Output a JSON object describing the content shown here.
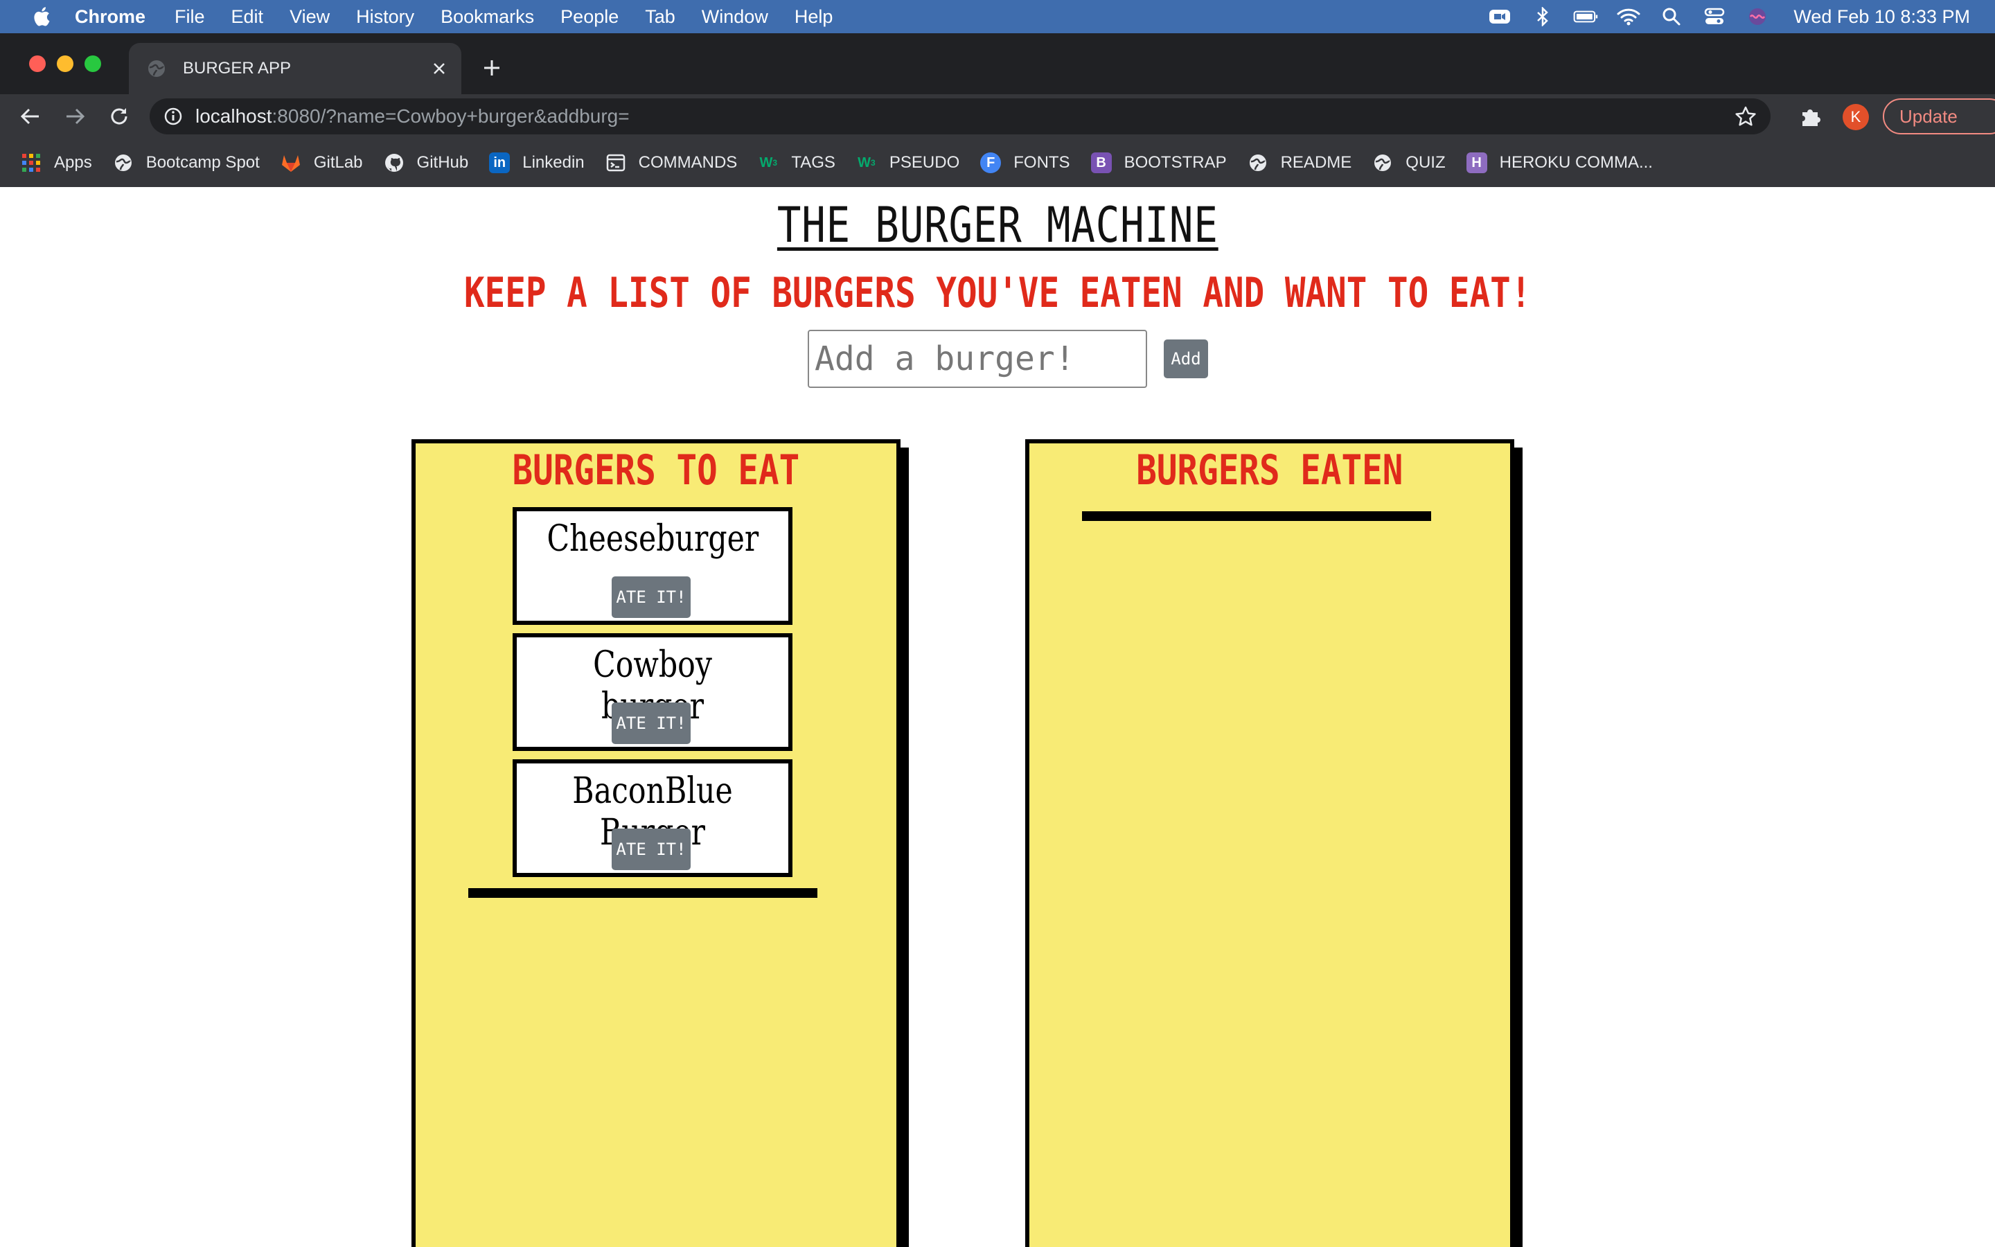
{
  "menubar": {
    "app_name": "Chrome",
    "items": [
      "File",
      "Edit",
      "View",
      "History",
      "Bookmarks",
      "People",
      "Tab",
      "Window",
      "Help"
    ],
    "clock": "Wed Feb 10  8:33 PM"
  },
  "browser": {
    "tab_title": "BURGER APP",
    "url_host": "localhost",
    "url_rest": ":8080/?name=Cowboy+burger&addburg=",
    "avatar_initial": "K",
    "update_label": "Update"
  },
  "bookmarks": [
    {
      "label": "Apps",
      "icon": "apps-grid-icon"
    },
    {
      "label": "Bootcamp Spot",
      "icon": "globe-icon"
    },
    {
      "label": "GitLab",
      "icon": "gitlab-icon"
    },
    {
      "label": "GitHub",
      "icon": "github-icon"
    },
    {
      "label": "Linkedin",
      "icon": "linkedin-icon"
    },
    {
      "label": "COMMANDS",
      "icon": "terminal-icon"
    },
    {
      "label": "TAGS",
      "icon": "w3schools-icon"
    },
    {
      "label": "PSEUDO",
      "icon": "w3schools-icon"
    },
    {
      "label": "FONTS",
      "icon": "fonts-icon"
    },
    {
      "label": "BOOTSTRAP",
      "icon": "bootstrap-icon"
    },
    {
      "label": "README",
      "icon": "globe-icon"
    },
    {
      "label": "QUIZ",
      "icon": "globe-icon"
    },
    {
      "label": "HEROKU COMMA...",
      "icon": "heroku-icon"
    }
  ],
  "page": {
    "title": "THE BURGER MACHINE",
    "subtitle": "KEEP A LIST OF BURGERS YOU'VE EATEN AND WANT TO EAT!",
    "add_placeholder": "Add a burger!",
    "add_button": "Add",
    "to_eat_title": "BURGERS TO EAT",
    "eaten_title": "BURGERS EATEN",
    "ate_button": "ATE IT!",
    "burgers_to_eat": [
      "Cheeseburger",
      "Cowboy burger",
      "BaconBlue Burger"
    ]
  },
  "colors": {
    "menubar": "#3f6dae",
    "column_bg": "#f8eb75",
    "heading_red": "#e02a1b",
    "button_gray": "#6c757d"
  }
}
